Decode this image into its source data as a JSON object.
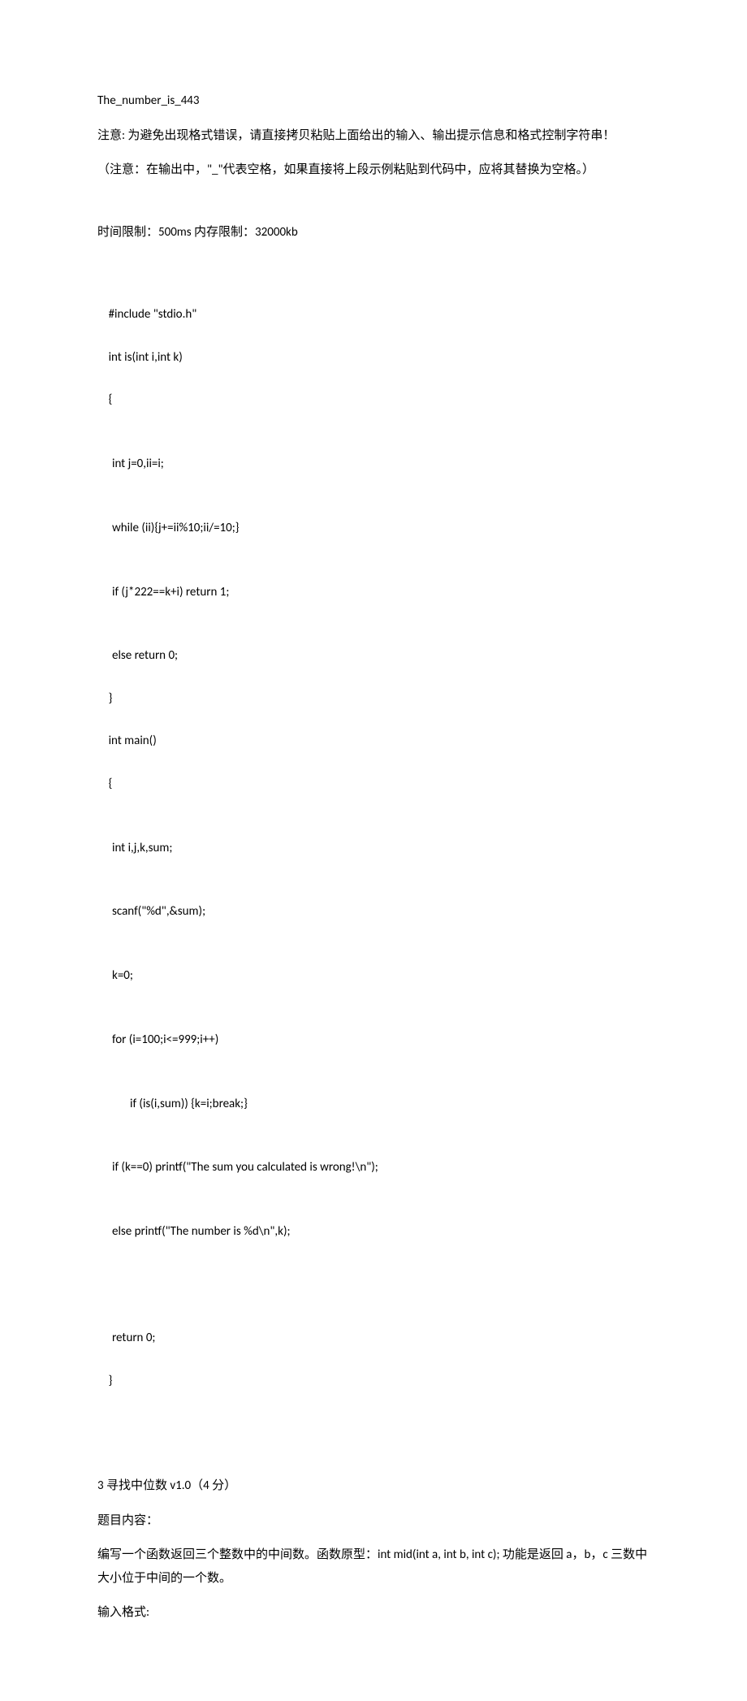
{
  "line_output": "The_number_is_443",
  "notice1": "注意: 为避免出现格式错误，请直接拷贝粘贴上面给出的输入、输出提示信息和格式控制字符串！",
  "notice2": "（注意：在输出中，\"_\"代表空格，如果直接将上段示例粘贴到代码中，应将其替换为空格。）",
  "limits": "时间限制：500ms 内存限制：32000kb",
  "code": {
    "l1": "#include \"stdio.h\"",
    "l2": "int is(int i,int k)",
    "l3": "{",
    "l4": "int j=0,ii=i;",
    "l5": "while (ii){j+=ii%10;ii/=10;}",
    "l6": "if (j*222==k+i) return 1;",
    "l7": "else return 0;",
    "l8": "}",
    "l9": "int main()",
    "l10": "{",
    "l11": "int i,j,k,sum;",
    "l12": "scanf(\"%d\",&sum);",
    "l13": "k=0;",
    "l14": "for (i=100;i<=999;i++)",
    "l15": "if (is(i,sum)) {k=i;break;}",
    "l16": "if (k==0) printf(\"The sum you calculated is wrong!\\n\");",
    "l17": "else printf(\"The number is %d\\n\",k);",
    "l18_blank": "",
    "l18": "return 0;",
    "l19": "}"
  },
  "q3": {
    "title": "3  寻找中位数 v1.0（4 分）",
    "content_label": "题目内容：",
    "content": "编写一个函数返回三个整数中的中间数。函数原型：int mid(int a, int b, int c);  功能是返回 a，b，c 三数中大小位于中间的一个数。",
    "input_label": "输入格式:"
  }
}
